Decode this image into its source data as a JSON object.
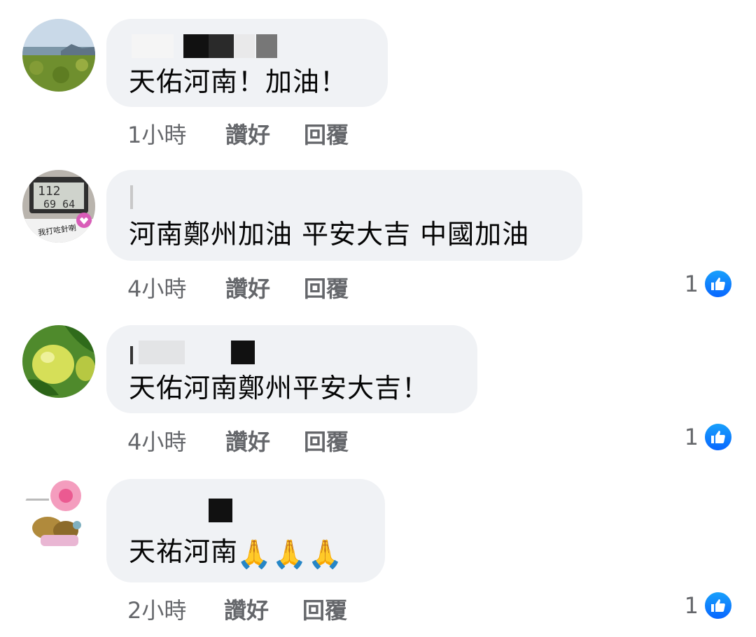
{
  "comments": [
    {
      "author_redacted": true,
      "text": "天佑河南！加油！",
      "time": "1小時",
      "like_label": "讚好",
      "reply_label": "回覆",
      "reactions": null
    },
    {
      "author_redacted": true,
      "avatar_text": "我打咗針喇",
      "text": "河南鄭州加油 平安大吉 中國加油",
      "time": "4小時",
      "like_label": "讚好",
      "reply_label": "回覆",
      "reactions": "1"
    },
    {
      "author_redacted": true,
      "text": "天佑河南鄭州平安大吉！",
      "time": "4小時",
      "like_label": "讚好",
      "reply_label": "回覆",
      "reactions": "1"
    },
    {
      "author_redacted": true,
      "text": "天祐河南",
      "text_emoji": "🙏🙏🙏",
      "time": "2小時",
      "like_label": "讚好",
      "reply_label": "回覆",
      "reactions": "1"
    }
  ],
  "colors": {
    "bubble": "#f0f2f5",
    "meta_text": "#65676b",
    "like_blue": "#0866ff"
  },
  "icons": [
    "thumbs-up-icon"
  ]
}
